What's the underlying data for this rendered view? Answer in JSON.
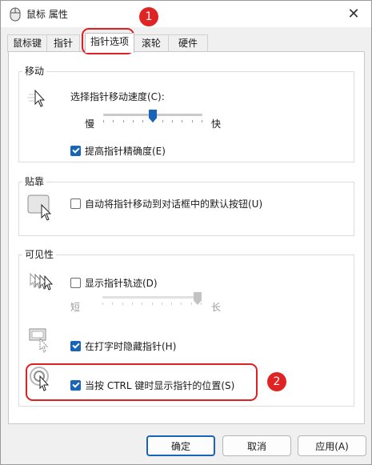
{
  "window": {
    "title": "鼠标 属性",
    "close_glyph": "✕",
    "icon": "mouse-icon"
  },
  "tabs": [
    {
      "label": "鼠标键",
      "active": false
    },
    {
      "label": "指针",
      "active": false
    },
    {
      "label": "指针选项",
      "active": true
    },
    {
      "label": "滚轮",
      "active": false
    },
    {
      "label": "硬件",
      "active": false
    }
  ],
  "motion": {
    "group_label": "移动",
    "speed_label": "选择指针移动速度(C):",
    "slow_label": "慢",
    "fast_label": "快",
    "speed_level": 0.5,
    "precision_label": "提高指针精确度(E)",
    "precision_checked": true,
    "icon": "pointer-speed-icon"
  },
  "snap": {
    "group_label": "贴靠",
    "snap_label": "自动将指针移动到对话框中的默认按钮(U)",
    "snap_checked": false,
    "icon": "snap-to-button-icon"
  },
  "visibility": {
    "group_label": "可见性",
    "trails_label": "显示指针轨迹(D)",
    "trails_checked": false,
    "short_label": "短",
    "long_label": "长",
    "trail_level": 1.0,
    "hide_label": "在打字时隐藏指针(H)",
    "hide_checked": true,
    "ctrl_label": "当按 CTRL 键时显示指针的位置(S)",
    "ctrl_checked": true,
    "icons": [
      "pointer-trails-icon",
      "hide-while-typing-icon",
      "ctrl-locate-icon"
    ]
  },
  "buttons": {
    "ok": "确定",
    "cancel": "取消",
    "apply": "应用(A)"
  },
  "annotations": {
    "marker_1": "1",
    "marker_2": "2",
    "color": "#e02020"
  },
  "colors": {
    "accent": "#1864b8",
    "annotation": "#e02020"
  }
}
